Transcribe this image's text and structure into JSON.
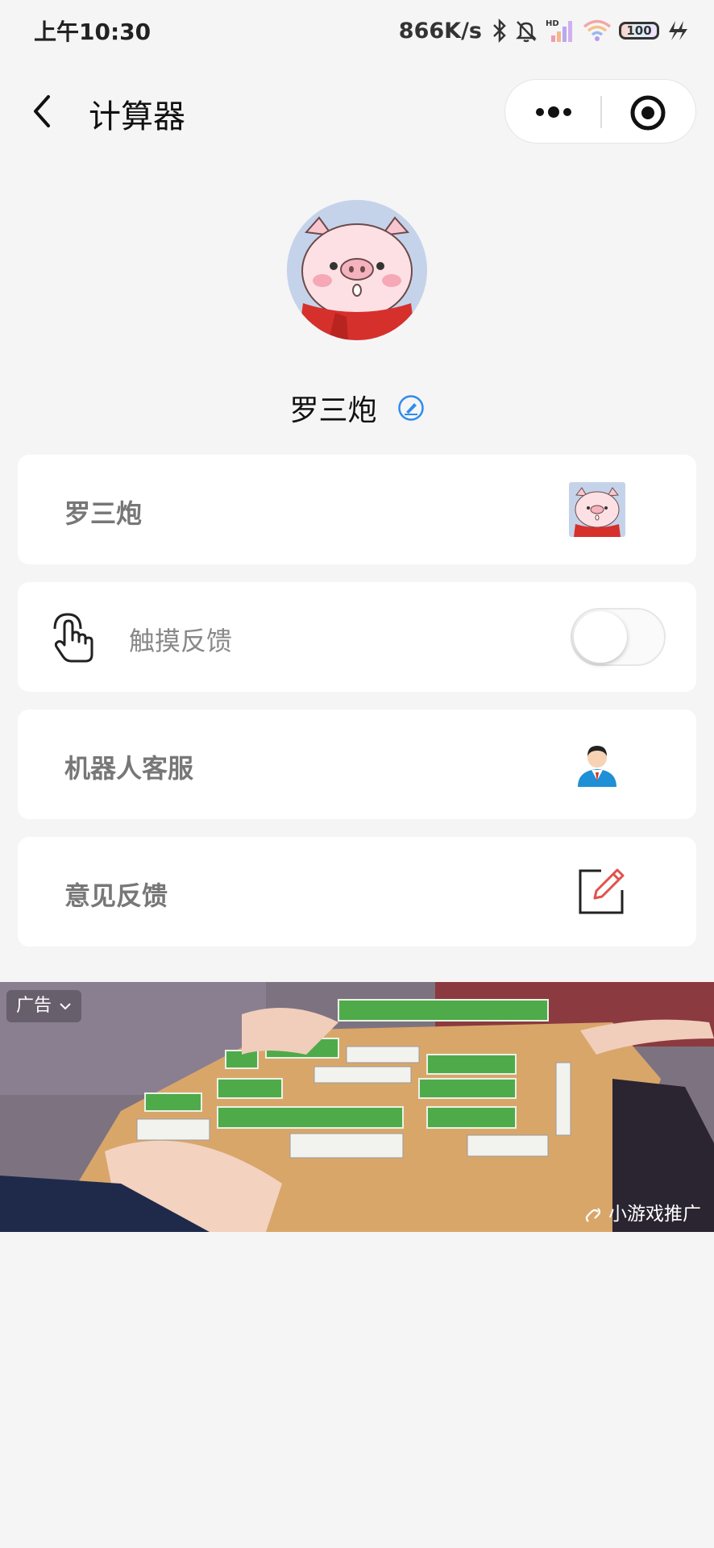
{
  "status_bar": {
    "time": "上午10:30",
    "net_speed": "866K/s",
    "battery": "100"
  },
  "nav": {
    "title": "计算器"
  },
  "profile": {
    "nickname": "罗三炮"
  },
  "cards": {
    "account_label": "罗三炮",
    "haptic_label": "触摸反馈",
    "haptic_enabled": false,
    "robot_label": "机器人客服",
    "feedback_label": "意见反馈"
  },
  "ad": {
    "tag": "广告",
    "source": "小游戏推广"
  },
  "colors": {
    "background": "#f5f5f5",
    "card": "#ffffff",
    "edit_accent": "#2d8cf0",
    "feedback_accent": "#e0524d"
  }
}
